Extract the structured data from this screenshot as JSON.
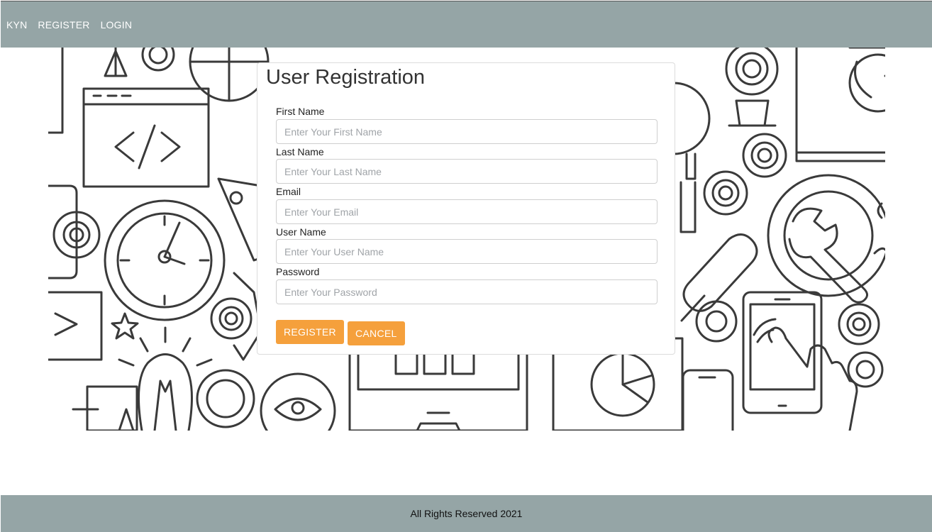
{
  "nav": {
    "brand": "KYN",
    "links": [
      "REGISTER",
      "LOGIN"
    ]
  },
  "hero": {
    "background_art": "line-art technology icons pattern"
  },
  "form": {
    "title": "User Registration",
    "fields": [
      {
        "label": "First Name",
        "placeholder": "Enter Your First Name",
        "value": ""
      },
      {
        "label": "Last Name",
        "placeholder": "Enter Your Last Name",
        "value": ""
      },
      {
        "label": "Email",
        "placeholder": "Enter Your Email",
        "value": ""
      },
      {
        "label": "User Name",
        "placeholder": "Enter Your User Name",
        "value": ""
      },
      {
        "label": "Password",
        "placeholder": "Enter Your Password",
        "value": ""
      }
    ],
    "buttons": {
      "register": "REGISTER",
      "cancel": "CANCEL"
    }
  },
  "footer": {
    "text": "All Rights Reserved 2021"
  },
  "colors": {
    "nav_bg": "#95a5a6",
    "button_bg": "#f5a03c"
  }
}
